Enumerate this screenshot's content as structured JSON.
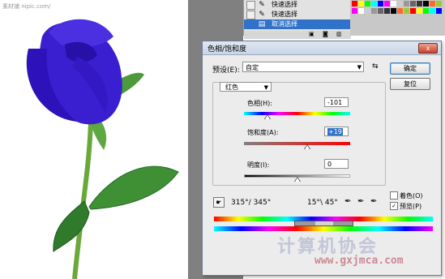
{
  "watermark": {
    "small_text": "素材铺 nipic.com/",
    "site_name": "计算机协会",
    "site_url": "www.gxjmca.com"
  },
  "history": {
    "items": [
      {
        "label": "快速选择",
        "icon": "quick-select-icon",
        "selected": false
      },
      {
        "label": "快速选择",
        "icon": "quick-select-icon",
        "selected": false
      },
      {
        "label": "取消选择",
        "icon": "deselect-icon",
        "selected": true
      }
    ]
  },
  "dialog": {
    "title": "色相/饱和度",
    "close_label": "x",
    "preset_label": "预设(E):",
    "preset_value": "自定",
    "ok_label": "确定",
    "reset_label": "复位",
    "channel_value": "红色",
    "hue_label": "色相(H):",
    "hue_value": "-101",
    "saturation_label": "饱和度(A):",
    "saturation_value": "+19",
    "lightness_label": "明度(I):",
    "lightness_value": "0",
    "range_left": "315°/ 345°",
    "range_right": "15°\\ 45°",
    "colorize_label": "着色(O)",
    "colorize_checked": false,
    "preview_label": "预览(P)",
    "preview_checked": true,
    "hue_fraction": 0.22,
    "saturation_fraction": 0.595,
    "lightness_fraction": 0.5
  },
  "colors": {
    "accent": "#3072c9",
    "rose": "#3a1fd0"
  }
}
